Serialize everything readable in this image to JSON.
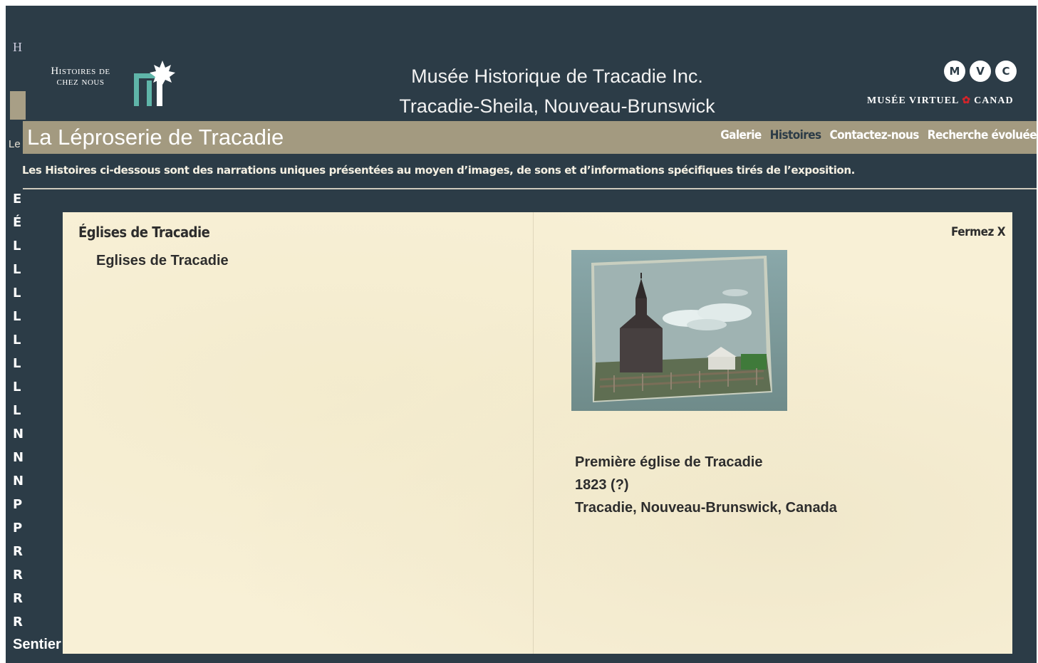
{
  "header": {
    "logo_left_text": [
      "Histoires de",
      "chez nous"
    ],
    "museum_name": "Musée Historique de Tracadie Inc.",
    "museum_location": "Tracadie-Sheila, Nouveau-Brunswick",
    "mvc_letters": [
      "M",
      "V",
      "C"
    ],
    "mvc_text_left": "MUSÉE VIRTUEL",
    "mvc_text_right": "CANAD"
  },
  "titlebar": {
    "section_title": "La Léproserie de Tracadie",
    "nav": [
      {
        "label": "Galerie",
        "active": false
      },
      {
        "label": "Histoires",
        "active": true
      },
      {
        "label": "Contactez-nous",
        "active": false
      },
      {
        "label": "Recherche évoluée",
        "active": false
      }
    ]
  },
  "intro": "Les Histoires ci-dessous sont des narrations uniques présentées au moyen d’images, de sons et d’informations spécifiques tirés de l’exposition.",
  "underlay": {
    "list_initials": [
      "E",
      "É",
      "L",
      "L",
      "L",
      "L",
      "L",
      "L",
      "L",
      "L",
      "N",
      "N",
      "N",
      "P",
      "P",
      "R",
      "R",
      "R",
      "R"
    ],
    "bottom_item": "Sentier patrimoine",
    "top_letter": "H",
    "le_fragment": "Le"
  },
  "modal": {
    "title": "Églises de Tracadie",
    "subtitle": "Eglises de Tracadie",
    "close_label": "Fermez X",
    "image_alt": "Painting of the first church of Tracadie",
    "caption": {
      "title": "Première église de Tracadie",
      "date": "1823 (?)",
      "place": "Tracadie, Nouveau-Brunswick, Canada"
    }
  },
  "colors": {
    "frame_bg": "#2c3c47",
    "titlebar_bg": "#a39a80",
    "modal_bg": "#f8f0d6",
    "mvc_maple": "#d4242a"
  }
}
